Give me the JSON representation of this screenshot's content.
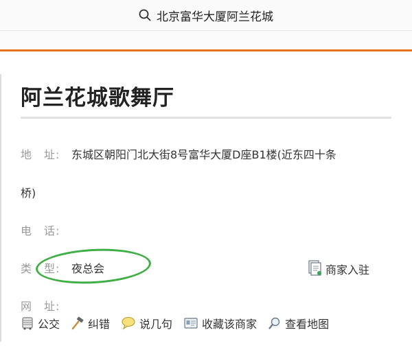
{
  "search": {
    "query": "北京富华大厦阿兰花城"
  },
  "venue": {
    "title": "阿兰花城歌舞厅",
    "address_label": "地　址:",
    "address_line1": "东城区朝阳门北大街8号富华大厦D座B1楼(近东四十条",
    "address_line2": "桥)",
    "phone_label": "电　话:",
    "phone_value": "",
    "type_label": "类　型:",
    "type_value": "夜总会",
    "website_label": "网　址:",
    "website_value": ""
  },
  "merchant_join": {
    "label": "商家入驻"
  },
  "actions": [
    {
      "label": "公交",
      "icon": "bus-icon"
    },
    {
      "label": "纠错",
      "icon": "hammer-icon"
    },
    {
      "label": "说几句",
      "icon": "speech-bubble-icon"
    },
    {
      "label": "收藏该商家",
      "icon": "bookmark-card-icon"
    },
    {
      "label": "查看地图",
      "icon": "magnifier-icon"
    }
  ],
  "colors": {
    "accent": "#e8731e",
    "annotation": "#3fae45"
  }
}
